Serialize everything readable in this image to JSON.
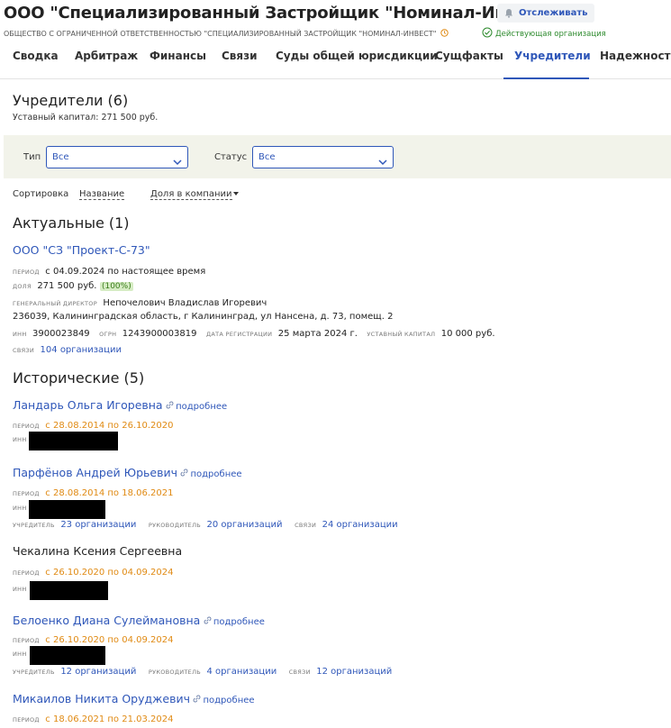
{
  "header": {
    "company_name": "ООО \"Специализированный Застройщик \"Номинал-Инвест\"",
    "watch_label": "Отслеживать",
    "full_name": "ОБЩЕСТВО С ОГРАНИЧЕННОЙ ОТВЕТСТВЕННОСТЬЮ \"СПЕЦИАЛИЗИРОВАННЫЙ ЗАСТРОЙЩИК \"НОМИНАЛ-ИНВЕСТ\"",
    "status_label": "Действующая организация",
    "status_color": "#2d8a2d"
  },
  "tabs": [
    "Сводка",
    "Арбитраж",
    "Финансы",
    "Связи",
    "Суды общей юрисдикции",
    "Сущфакты",
    "Учредители",
    "Надежность"
  ],
  "active_tab": "Учредители",
  "founders": {
    "title": "Учредители (6)",
    "capital": "Уставный капитал: 271 500 руб."
  },
  "filters": {
    "type_label": "Тип",
    "type_value": "Все",
    "status_label": "Статус",
    "status_value": "Все"
  },
  "sort": {
    "label": "Сортировка",
    "by_name": "Название",
    "by_share": "Доля в компании"
  },
  "current": {
    "title": "Актуальные (1)",
    "name": "ООО \"СЗ \"Проект-С-73\"",
    "period_label": "период",
    "period_value": "с 04.09.2024 по настоящее время",
    "share_label": "доля",
    "share_value": "271 500 руб.",
    "share_pct": "(100%)",
    "director_label": "генеральный директор",
    "director_value": "Непочелович Владислав Игоревич",
    "address": "236039, Калининградская область, г Калининград, ул Нансена, д. 73, помещ. 2",
    "inn_label": "инн",
    "inn_value": "3900023849",
    "ogrn_label": "огрн",
    "ogrn_value": "1243900003819",
    "reg_label": "дата регистрации",
    "reg_value": "25 марта 2024 г.",
    "capital_label": "уставный капитал",
    "capital_value": "10 000 руб.",
    "links_label": "связи",
    "links_value": "104 организации"
  },
  "historical": {
    "title": "Исторические (5)",
    "more_label": "подробнее",
    "period_label": "период",
    "inn_label": "инн",
    "founder_label": "учредитель",
    "head_label": "руководитель",
    "links_label": "связи",
    "items": [
      {
        "name": "Ландарь Ольга Игоревна",
        "period": "с 28.08.2014 по 26.10.2020"
      },
      {
        "name": "Парфёнов Андрей Юрьевич",
        "period": "с 28.08.2014 по 18.06.2021",
        "founder": "23 организации",
        "head": "20 организаций",
        "links": "24 организации"
      },
      {
        "name": "Чекалина Ксения Сергеевна",
        "period": "с 26.10.2020 по 04.09.2024"
      },
      {
        "name": "Белоенко Диана Сулеймановна",
        "period": "с 26.10.2020 по 04.09.2024",
        "founder": "12 организаций",
        "head": "4 организации",
        "links": "12 организаций"
      },
      {
        "name": "Микаилов Никита Оруджевич",
        "period": "с 18.06.2021 по 21.03.2024"
      }
    ]
  },
  "colors": {
    "accent": "#2f57b9",
    "period_orange": "#e08a13",
    "filter_bg": "#f2f3ea"
  }
}
